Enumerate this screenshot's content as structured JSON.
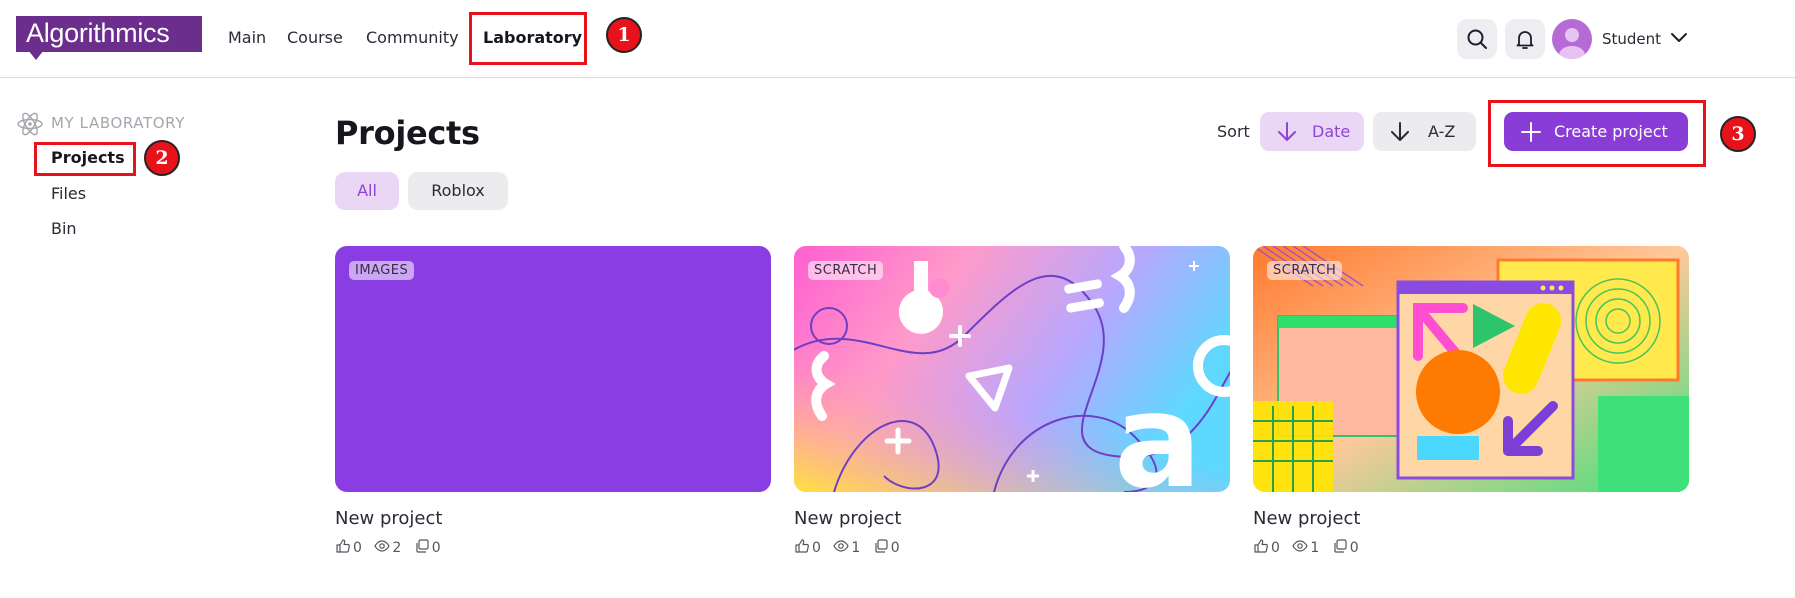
{
  "header": {
    "logo_text": "Algorithmics",
    "brand_color": "#6b2e8c",
    "nav": [
      {
        "label": "Main"
      },
      {
        "label": "Course"
      },
      {
        "label": "Community"
      },
      {
        "label": "Laboratory",
        "active": true
      }
    ],
    "user": {
      "name": "Student"
    },
    "icons": [
      "search-icon",
      "bell-icon",
      "avatar",
      "chevron-down-icon"
    ]
  },
  "annotations": [
    "1",
    "2",
    "3"
  ],
  "sidebar": {
    "title": "MY LABORATORY",
    "items": [
      {
        "label": "Projects",
        "active": true
      },
      {
        "label": "Files"
      },
      {
        "label": "Bin"
      }
    ]
  },
  "main": {
    "title": "Projects",
    "sort": {
      "label": "Sort",
      "options": [
        {
          "label": "Date",
          "active": true
        },
        {
          "label": "A-Z"
        }
      ]
    },
    "create_label": "Create project",
    "filters": [
      {
        "label": "All",
        "active": true
      },
      {
        "label": "Roblox"
      }
    ],
    "projects": [
      {
        "tag": "IMAGES",
        "title": "New project",
        "likes": "0",
        "views": "2",
        "forks": "0"
      },
      {
        "tag": "SCRATCH",
        "title": "New project",
        "likes": "0",
        "views": "1",
        "forks": "0"
      },
      {
        "tag": "SCRATCH",
        "title": "New project",
        "likes": "0",
        "views": "1",
        "forks": "0"
      }
    ]
  },
  "colors": {
    "accent": "#8a3dd6",
    "accent_soft": "#ead7f6",
    "annotation_red": "#e8131a"
  }
}
